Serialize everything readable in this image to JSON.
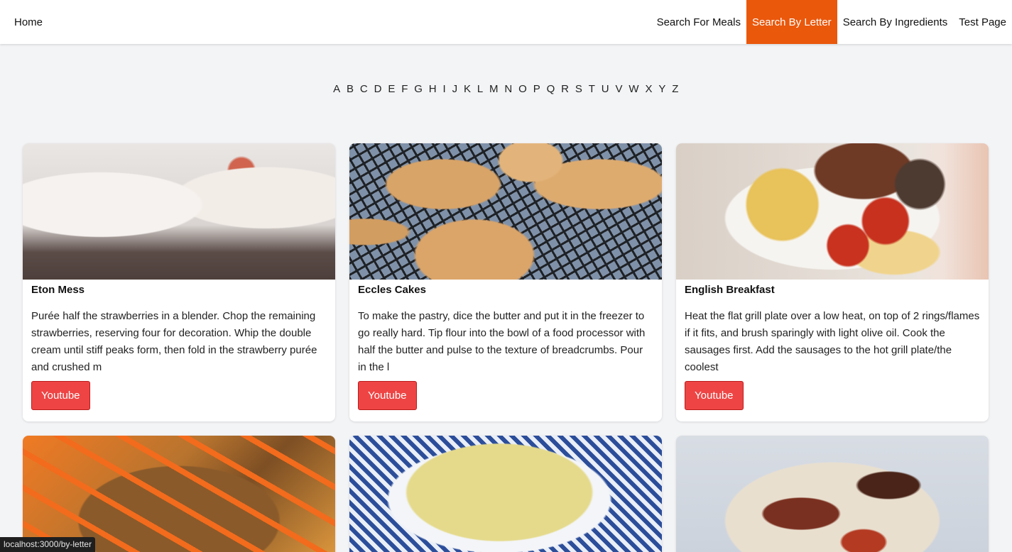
{
  "nav": {
    "home": "Home",
    "links": [
      "Search For Meals",
      "Search By Letter",
      "Search By Ingredients",
      "Test Page"
    ],
    "active": "Search By Letter",
    "active_color": "#ea580c"
  },
  "letters": [
    "A",
    "B",
    "C",
    "D",
    "E",
    "F",
    "G",
    "H",
    "I",
    "J",
    "K",
    "L",
    "M",
    "N",
    "O",
    "P",
    "Q",
    "R",
    "S",
    "T",
    "U",
    "V",
    "W",
    "X",
    "Y",
    "Z"
  ],
  "meals": [
    {
      "title": "Eton Mess",
      "description": "Purée half the strawberries in a blender. Chop the remaining strawberries, reserving four for decoration. Whip the double cream until stiff peaks form, then fold in the strawberry purée and crushed m",
      "button": "Youtube"
    },
    {
      "title": "Eccles Cakes",
      "description": "To make the pastry, dice the butter and put it in the freezer to go really hard. Tip flour into the bowl of a food processor with half the butter and pulse to the texture of breadcrumbs. Pour in the l",
      "button": "Youtube"
    },
    {
      "title": "English Breakfast",
      "description": "Heat the flat grill plate over a low heat, on top of 2 rings/flames if it fits, and brush sparingly with light olive oil. Cook the sausages first. Add the sausages to the hot grill plate/the coolest",
      "button": "Youtube"
    }
  ],
  "button_color": "#ef4444",
  "status_url": "localhost:3000/by-letter"
}
